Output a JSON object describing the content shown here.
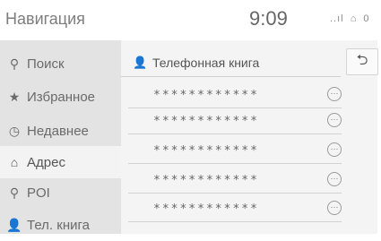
{
  "header": {
    "title": "Навигация",
    "time": "9:09",
    "status_icons": [
      "signal-icon",
      "phone-icon",
      "bluetooth-icon"
    ],
    "status_glyphs": [
      "..ıl",
      "⌂",
      "0"
    ]
  },
  "sidebar": {
    "items": [
      {
        "label": "Поиск",
        "icon": "search-icon",
        "glyph": "⚲"
      },
      {
        "label": "Избранное",
        "icon": "star-icon",
        "glyph": "★"
      },
      {
        "label": "Недавнее",
        "icon": "clock-icon",
        "glyph": "◷"
      },
      {
        "label": "Адрес",
        "icon": "address-icon",
        "glyph": "⌂",
        "selected": true
      },
      {
        "label": "POI",
        "icon": "poi-pin-icon",
        "glyph": "⚲"
      },
      {
        "label": "Тел. книга",
        "icon": "person-icon",
        "glyph": "👤"
      }
    ]
  },
  "main": {
    "header_label": "Телефонная книга",
    "header_icon": "person-icon",
    "back_icon": "back-arrow-icon",
    "back_glyph": "⮌",
    "rows": [
      {
        "text": "************",
        "more_icon": "more-icon"
      },
      {
        "text": "************",
        "more_icon": "more-icon"
      },
      {
        "text": "************",
        "more_icon": "more-icon"
      },
      {
        "text": "************",
        "more_icon": "more-icon"
      },
      {
        "text": "************",
        "more_icon": "more-icon"
      }
    ]
  }
}
